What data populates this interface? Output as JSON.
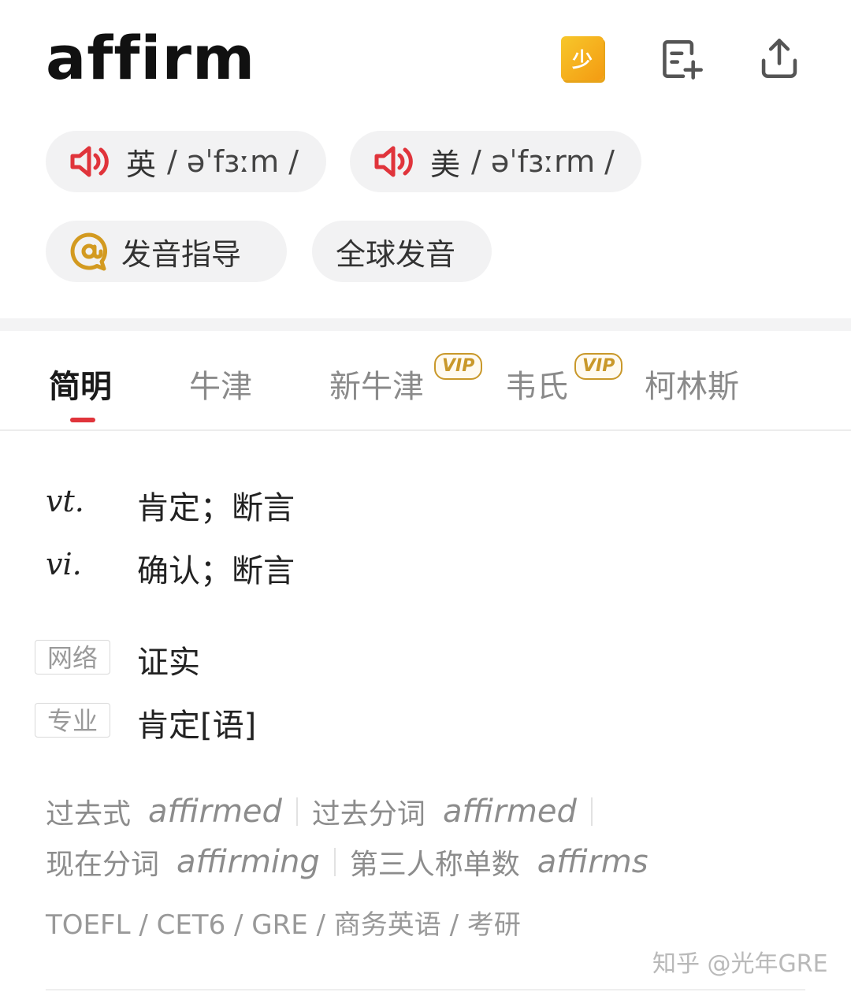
{
  "header": {
    "word": "affirm",
    "badge_label": "少",
    "icons": [
      "badge-icon",
      "note-add-icon",
      "share-icon"
    ]
  },
  "pronunciation": {
    "uk": {
      "label": "英",
      "phonetic": "/ əˈfɜːm /"
    },
    "us": {
      "label": "美",
      "phonetic": "/ əˈfɜːrm /"
    },
    "guide": "发音指导",
    "global": "全球发音"
  },
  "tabs": [
    {
      "label": "简明",
      "active": true
    },
    {
      "label": "牛津"
    },
    {
      "label": "新牛津",
      "vip": "VIP"
    },
    {
      "label": "韦氏",
      "vip": "VIP"
    },
    {
      "label": "柯林斯"
    }
  ],
  "definitions": [
    {
      "pos": "vt.",
      "meaning": "肯定；断言"
    },
    {
      "pos": "vi.",
      "meaning": "确认；断言"
    }
  ],
  "tagged_meanings": [
    {
      "tag": "网络",
      "meaning": "证实"
    },
    {
      "tag": "专业",
      "meaning": "肯定[语]"
    }
  ],
  "word_forms": [
    {
      "label": "过去式",
      "form": "affirmed"
    },
    {
      "label": "过去分词",
      "form": "affirmed"
    },
    {
      "label": "现在分词",
      "form": "affirming"
    },
    {
      "label": "第三人称单数",
      "form": "affirms"
    }
  ],
  "exams": "TOEFL / CET6 / GRE / 商务英语 / 考研",
  "watermark": "知乎 @光年GRE",
  "colors": {
    "accent_red": "#e0343b",
    "vip_gold": "#c9982a",
    "badge_orange": "#f49b12"
  }
}
